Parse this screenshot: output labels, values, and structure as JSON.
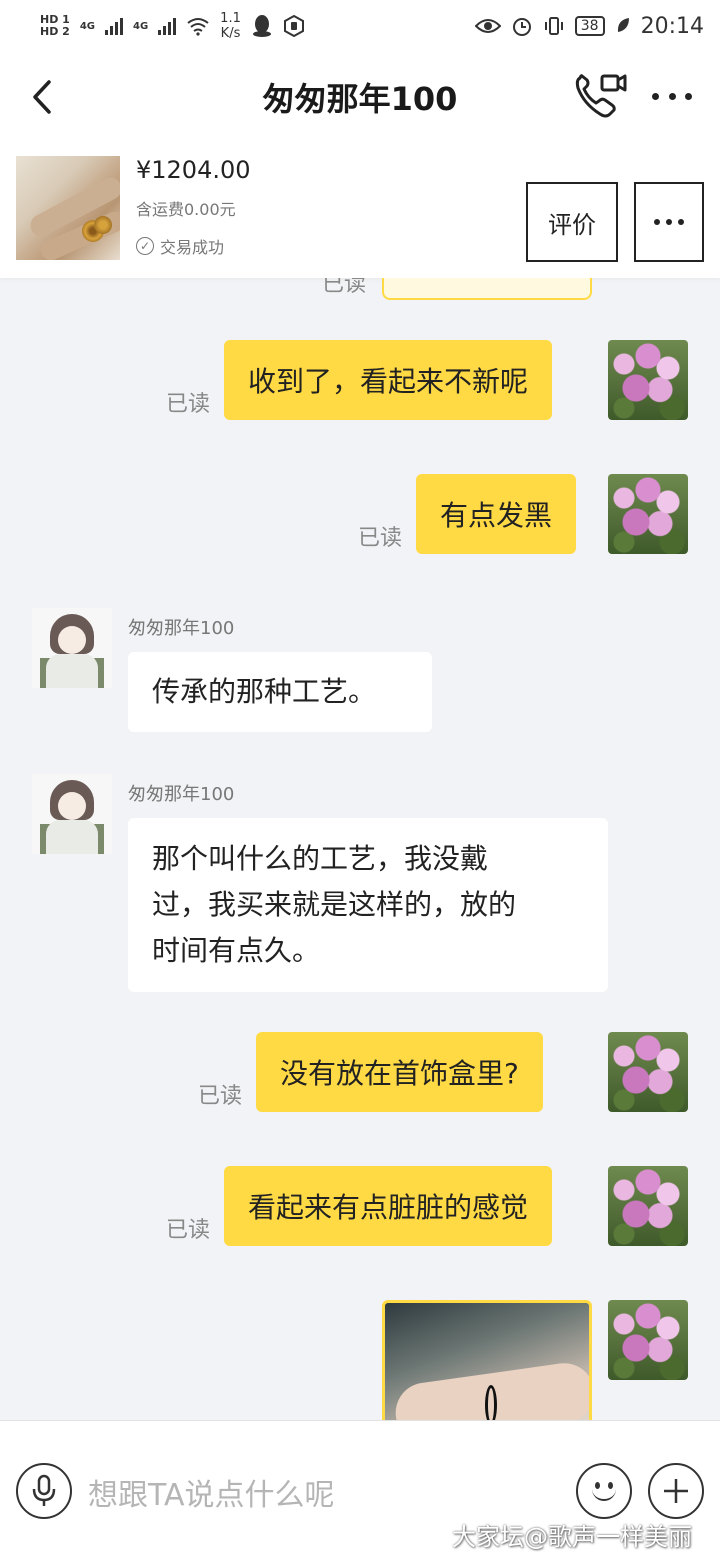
{
  "status_bar": {
    "badge1": "HD 1",
    "badge2": "HD 2",
    "net1": "4G",
    "net2": "4G",
    "speed_value": "1.1",
    "speed_unit": "K/s",
    "battery": "38",
    "time": "20:14"
  },
  "header": {
    "title": "匆匆那年100"
  },
  "product": {
    "price": "¥1204.00",
    "shipping": "含运费0.00元",
    "status": "交易成功",
    "review_label": "评价"
  },
  "chat": {
    "top_read": "已读",
    "messages": [
      {
        "from": "me",
        "text": "收到了，看起来不新呢",
        "read": "已读"
      },
      {
        "from": "me",
        "text": "有点发黑",
        "read": "已读"
      },
      {
        "from": "other",
        "sender": "匆匆那年100",
        "text": "传承的那种工艺。"
      },
      {
        "from": "other",
        "sender": "匆匆那年100",
        "lines": [
          "那个叫什么的工艺，我没戴",
          "过，我买来就是这样的，放的",
          "时间有点久。"
        ]
      },
      {
        "from": "me",
        "text": "没有放在首饰盒里?",
        "read": "已读"
      },
      {
        "from": "me",
        "text": "看起来有点脏脏的感觉",
        "read": "已读"
      },
      {
        "from": "me",
        "type": "image"
      }
    ]
  },
  "input": {
    "placeholder": "想跟TA说点什么呢"
  },
  "watermark": "大家坛@歌声一样美丽",
  "colors": {
    "bubble_out": "#ffda44",
    "bubble_in": "#ffffff",
    "chat_bg": "#f2f3f6"
  }
}
